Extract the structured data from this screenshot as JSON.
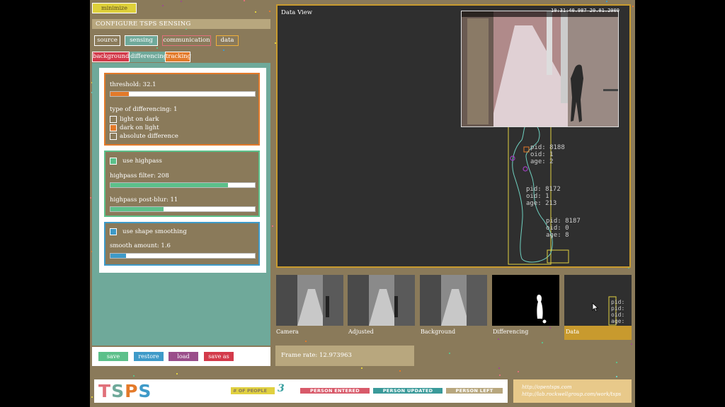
{
  "minimize_label": "minimize",
  "config_title": "CONFIGURE TSPS SENSING",
  "main_tabs": [
    {
      "label": "source"
    },
    {
      "label": "sensing"
    },
    {
      "label": "communication"
    },
    {
      "label": "data"
    }
  ],
  "sub_tabs": [
    {
      "label": "background"
    },
    {
      "label": "differencing"
    },
    {
      "label": "tracking"
    }
  ],
  "threshold": {
    "label": "threshold: 32.1",
    "fraction": 0.126
  },
  "differencing_type": {
    "label": "type of differencing: 1",
    "options": [
      {
        "label": "light on dark",
        "checked": false
      },
      {
        "label": "dark on light",
        "checked": true
      },
      {
        "label": "absolute difference",
        "checked": false
      }
    ]
  },
  "highpass": {
    "toggle_label": "use highpass",
    "filter_label": "highpass filter: 208",
    "filter_fraction": 0.816,
    "postblur_label": "highpass post-blur: 11",
    "postblur_fraction": 0.37
  },
  "smoothing": {
    "toggle_label": "use shape smoothing",
    "amount_label": "smooth amount: 1.6",
    "amount_fraction": 0.11
  },
  "actions": {
    "save": "save",
    "restore": "restore",
    "load": "load",
    "save_as": "save as"
  },
  "data_view": {
    "title": "Data View",
    "timestamp": "10:31:40.987  20.01.2009",
    "blobs": [
      {
        "text": "pid: 8188\noid: 1\nage: 2"
      },
      {
        "text": "pid: 8172\noid: 1\nage: 213"
      },
      {
        "text": "pid: 8187\noid: 0\nage: 8"
      }
    ]
  },
  "thumbnails": [
    {
      "label": "Camera"
    },
    {
      "label": "Adjusted"
    },
    {
      "label": "Background"
    },
    {
      "label": "Differencing"
    },
    {
      "label": "Data"
    }
  ],
  "mini_data_text": "pid:\npid:\noid:\nage:\nage:",
  "frame_rate": "Frame rate: 12.973963",
  "footer": {
    "logo": "TSPS",
    "people_label": "# OF PEOPLE",
    "people_count": "3",
    "legend": [
      "PERSON ENTERED",
      "PERSON UPDATED",
      "PERSON LEFT"
    ],
    "url1": "http://opentsps.com",
    "url2": "http://lab.rockwellgroup.com/work/tsps"
  },
  "colors": {
    "teal": "#6fa99a",
    "orange": "#e37a2a",
    "green": "#5cc08a",
    "blue": "#3e9ac8",
    "pink": "#e0707a",
    "purple": "#9a4e8a",
    "red": "#d33a4a",
    "gold": "#c89a2e"
  }
}
